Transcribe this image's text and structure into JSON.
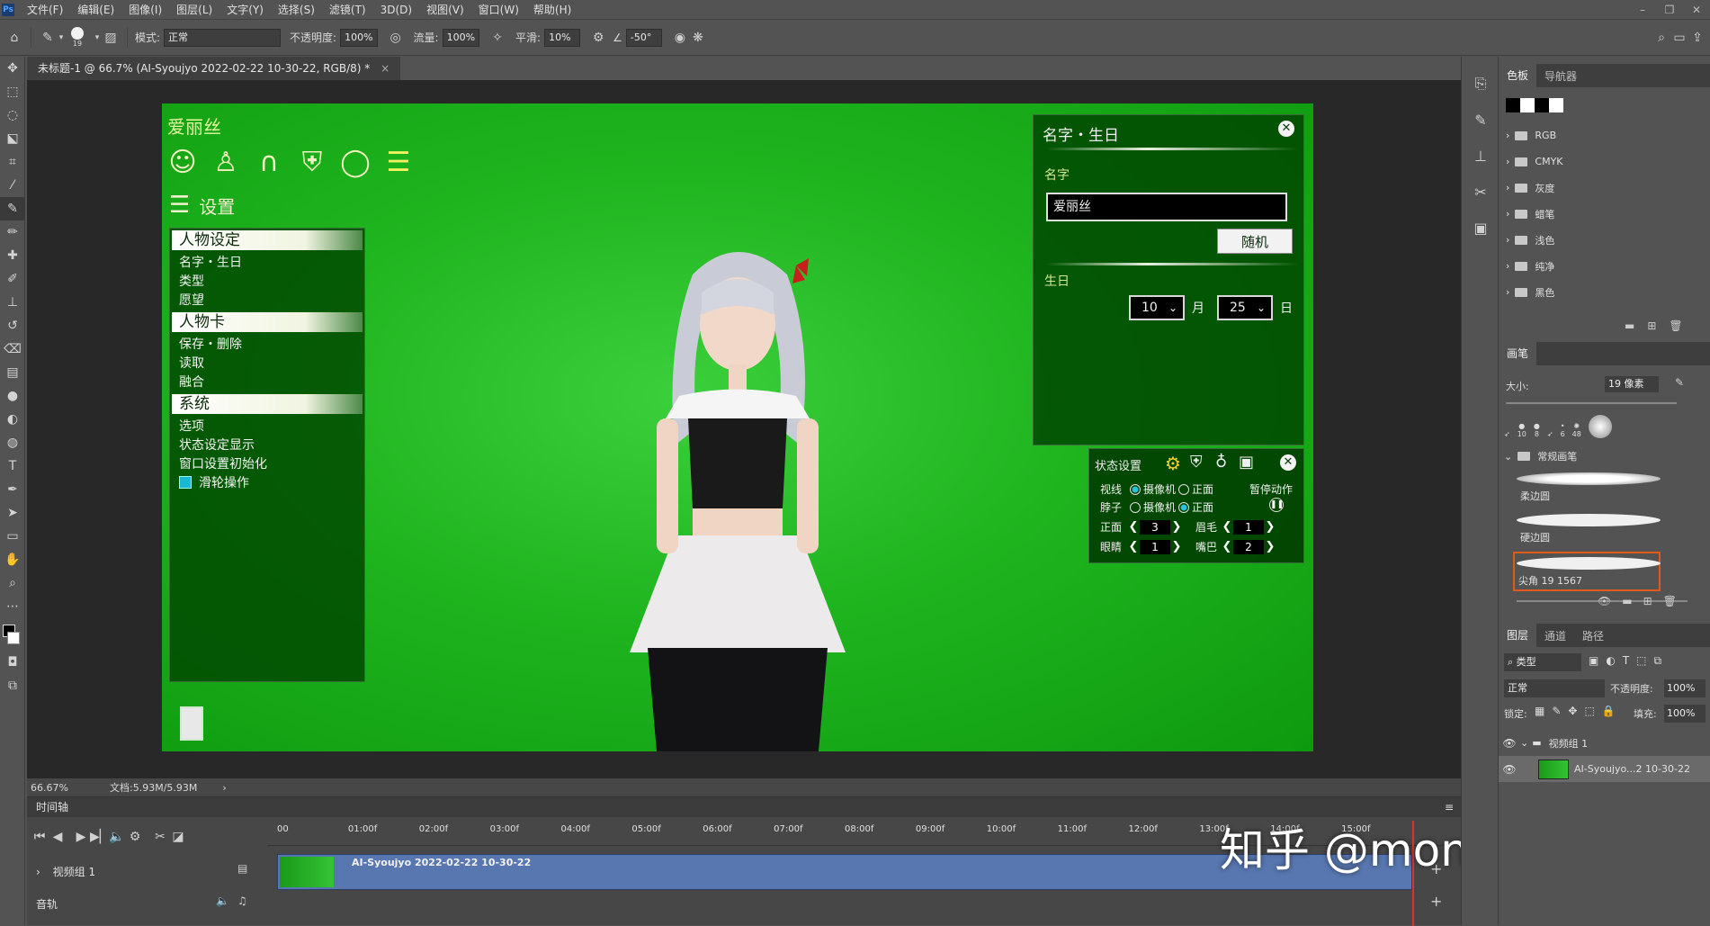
{
  "menu": [
    "文件(F)",
    "编辑(E)",
    "图像(I)",
    "图层(L)",
    "文字(Y)",
    "选择(S)",
    "滤镜(T)",
    "3D(D)",
    "视图(V)",
    "窗口(W)",
    "帮助(H)"
  ],
  "options": {
    "brush_size": "19",
    "mode_label": "模式:",
    "mode_value": "正常",
    "opacity_label": "不透明度:",
    "opacity_value": "100%",
    "flow_label": "流量:",
    "flow_value": "100%",
    "smooth_label": "平滑:",
    "smooth_value": "10%",
    "angle_value": "-50°"
  },
  "document": {
    "tab_title": "未标题-1 @ 66.7% (AI-Syoujyo 2022-02-22 10-30-22, RGB/8) *",
    "zoom": "66.67%",
    "doc_info": "文档:5.93M/5.93M"
  },
  "game": {
    "char_name": "爱丽丝",
    "settings_title": "设置",
    "sections": [
      {
        "title": "人物设定",
        "items": [
          "名字・生日",
          "类型",
          "愿望"
        ]
      },
      {
        "title": "人物卡",
        "items": [
          "保存・删除",
          "读取",
          "融合"
        ]
      },
      {
        "title": "系统",
        "items": [
          "选项",
          "状态设定显示",
          "窗口设置初始化",
          "滑轮操作"
        ]
      }
    ],
    "name_panel": {
      "title": "名字・生日",
      "name_label": "名字",
      "name_value": "爱丽丝",
      "random_button": "随机",
      "birthday_label": "生日",
      "month_value": "10",
      "month_unit": "月",
      "day_value": "25",
      "day_unit": "日"
    },
    "state_panel": {
      "title": "状态设置",
      "gaze_label": "视线",
      "neck_label": "脖子",
      "camera": "摄像机",
      "front": "正面",
      "pause_label": "暂停动作",
      "front_label": "正面",
      "front_value": "3",
      "brow_label": "眉毛",
      "brow_value": "1",
      "eyes_label": "眼睛",
      "eyes_value": "1",
      "mouth_label": "嘴巴",
      "mouth_value": "2"
    }
  },
  "timeline": {
    "title": "时间轴",
    "ticks": [
      "00",
      "01:00f",
      "02:00f",
      "03:00f",
      "04:00f",
      "05:00f",
      "06:00f",
      "07:00f",
      "08:00f",
      "09:00f",
      "10:00f",
      "11:00f",
      "12:00f",
      "13:00f",
      "14:00f",
      "15:00f"
    ],
    "track_name": "视频组 1",
    "audio_name": "音轨",
    "clip_name": "AI-Syoujyo 2022-02-22 10-30-22"
  },
  "watermark": "知乎 @monkeyjess",
  "swatches": {
    "tabs": [
      "色板",
      "导航器"
    ],
    "groups": [
      "RGB",
      "CMYK",
      "灰度",
      "蜡笔",
      "浅色",
      "纯净",
      "黑色"
    ]
  },
  "brushes": {
    "tab": "画笔",
    "size_label": "大小:",
    "size_value": "19 像素",
    "preset_sizes": [
      "10",
      "8",
      "6",
      "48"
    ],
    "group_name": "常规画笔",
    "items": [
      "柔边圆",
      "硬边圆",
      "尖角 19 1567"
    ]
  },
  "layers": {
    "tabs": [
      "图层",
      "通道",
      "路径"
    ],
    "filter_label": "类型",
    "blend_mode": "正常",
    "opacity_label": "不透明度:",
    "opacity_value": "100%",
    "lock_label": "锁定:",
    "fill_label": "填充:",
    "fill_value": "100%",
    "group_name": "视频组 1",
    "layer_name": "AI-Syoujyo...2 10-30-22"
  }
}
